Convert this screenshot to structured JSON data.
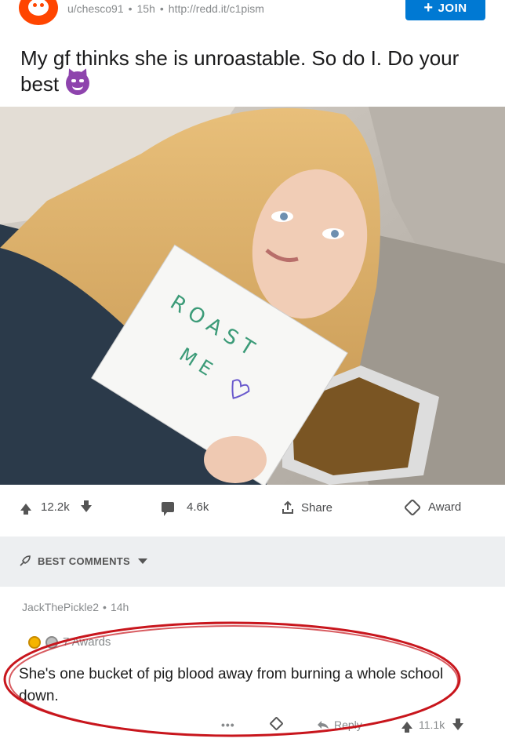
{
  "post": {
    "author": "u/chesco91",
    "age": "15h",
    "link": "http://redd.it/c1pism",
    "join_label": "JOIN",
    "title": "My gf thinks she is unroastable. So do I. Do your best",
    "sign_line1": "ROAST",
    "sign_line2": "ME"
  },
  "actions": {
    "upvotes": "12.2k",
    "comments": "4.6k",
    "share": "Share",
    "award": "Award"
  },
  "sort": {
    "label": "BEST COMMENTS"
  },
  "comment": {
    "author": "JackThePickle2",
    "age": "14h",
    "awards": "7 Awards",
    "body": "She's one bucket of pig blood away from burning a whole school down.",
    "more": "•••",
    "reply": "Reply",
    "score": "11.1k"
  },
  "colors": {
    "join": "#0079d3",
    "avatar": "#ff4500",
    "annotation": "#c8161d",
    "emoji": "#8e44ad"
  }
}
